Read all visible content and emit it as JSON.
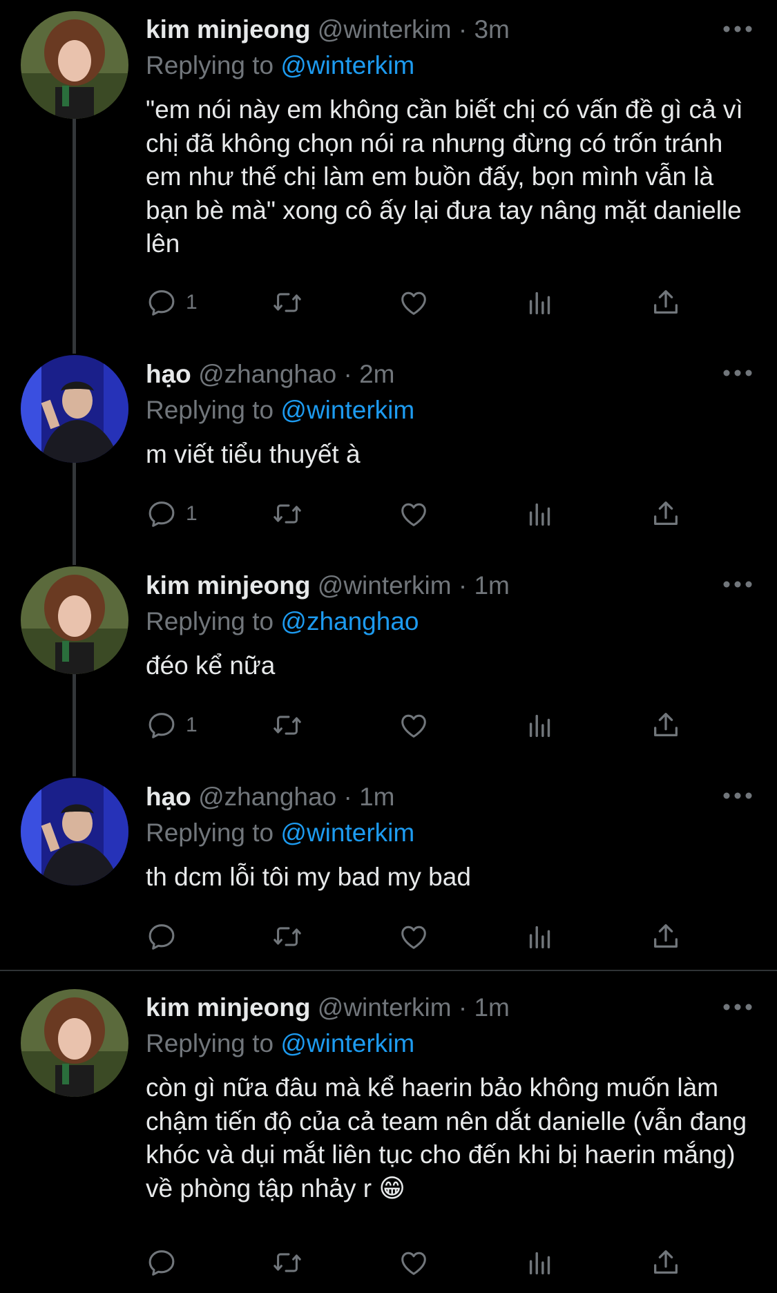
{
  "tweets": [
    {
      "name": "kim minjeong",
      "handle": "@winterkim",
      "time": "3m",
      "replying_label": "Replying to",
      "replying_to": "@winterkim",
      "text": "\"em nói này em không cần biết chị có vấn đề gì cả vì chị đã không chọn nói ra nhưng đừng có trốn tránh em như thế chị làm em buồn đấy, bọn mình vẫn là bạn bè mà\" xong cô ấy lại đưa tay nâng mặt danielle lên",
      "reply_count": "1"
    },
    {
      "name": "hạo",
      "handle": "@zhanghao",
      "time": "2m",
      "replying_label": "Replying to",
      "replying_to": "@winterkim",
      "text": "m viết tiểu thuyết à",
      "reply_count": "1"
    },
    {
      "name": "kim minjeong",
      "handle": "@winterkim",
      "time": "1m",
      "replying_label": "Replying to",
      "replying_to": "@zhanghao",
      "text": "đéo kể nữa",
      "reply_count": "1"
    },
    {
      "name": "hạo",
      "handle": "@zhanghao",
      "time": "1m",
      "replying_label": "Replying to",
      "replying_to": "@winterkim",
      "text": "th dcm lỗi tôi my bad my bad",
      "reply_count": ""
    },
    {
      "name": "kim minjeong",
      "handle": "@winterkim",
      "time": "1m",
      "replying_label": "Replying to",
      "replying_to": "@winterkim",
      "text": "còn gì nữa đâu mà kể haerin bảo không muốn làm chậm tiến độ của cả team nên dắt danielle (vẫn đang khóc và dụi mắt liên tục cho đến khi bị haerin mắng) về phòng tập nhảy r 😁",
      "reply_count": ""
    }
  ],
  "separator": "·",
  "colors": {
    "background": "#000000",
    "text": "#e7e9ea",
    "muted": "#71767b",
    "link": "#1d9bf0",
    "thread_line": "#333639"
  },
  "icons": [
    "reply-icon",
    "retweet-icon",
    "like-icon",
    "analytics-icon",
    "share-icon",
    "more-icon"
  ]
}
